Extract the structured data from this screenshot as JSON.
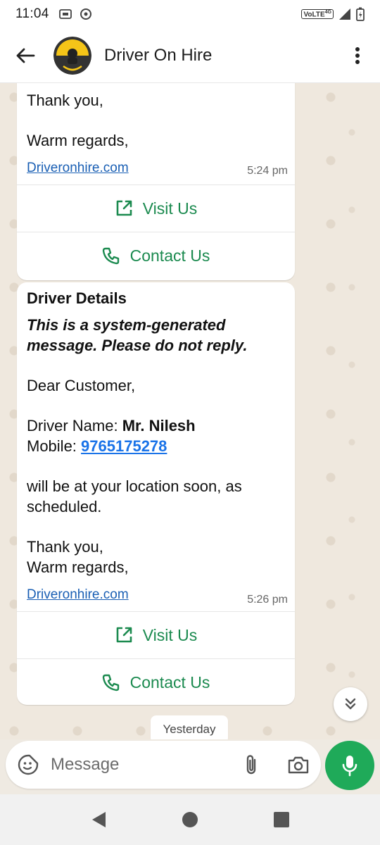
{
  "status_bar": {
    "time": "11:04",
    "network_label": "VoLTE",
    "network_gen": "4G"
  },
  "header": {
    "title": "Driver On Hire"
  },
  "messages": [
    {
      "lines": [
        "Thank you,",
        "Warm regards,"
      ],
      "link": "Driveronhire.com",
      "time": "5:24 pm",
      "buttons": [
        {
          "label": "Visit Us"
        },
        {
          "label": "Contact Us"
        }
      ]
    },
    {
      "title": "Driver Details",
      "notice": "This is a system-generated message. Please do not reply.",
      "greeting": "Dear Customer,",
      "driver_name_label": "Driver Name: ",
      "driver_name": "Mr. Nilesh",
      "mobile_label": "Mobile: ",
      "mobile": "9765175278",
      "body": "will be at your location soon, as scheduled.",
      "sign_off_1": "Thank you,",
      "sign_off_2": "Warm regards,",
      "link": "Driveronhire.com",
      "time": "5:26 pm",
      "buttons": [
        {
          "label": "Visit Us"
        },
        {
          "label": "Contact Us"
        }
      ]
    }
  ],
  "date_chip": "Yesterday",
  "composer": {
    "placeholder": "Message"
  },
  "colors": {
    "accent": "#1faa59",
    "action_text": "#1b8a4f",
    "link": "#1a5fb4"
  }
}
